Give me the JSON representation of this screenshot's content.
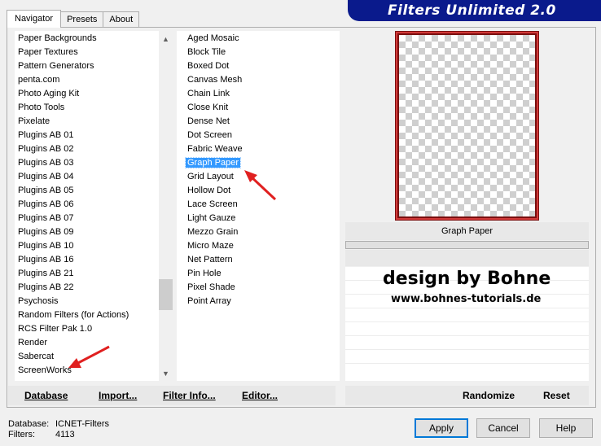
{
  "tabs": [
    {
      "label": "Navigator"
    },
    {
      "label": "Presets"
    },
    {
      "label": "About"
    }
  ],
  "banner": {
    "title": "Filters Unlimited 2.0"
  },
  "categories": [
    "Paper Backgrounds",
    "Paper Textures",
    "Pattern Generators",
    "penta.com",
    "Photo Aging Kit",
    "Photo Tools",
    "Pixelate",
    "Plugins AB 01",
    "Plugins AB 02",
    "Plugins AB 03",
    "Plugins AB 04",
    "Plugins AB 05",
    "Plugins AB 06",
    "Plugins AB 07",
    "Plugins AB 09",
    "Plugins AB 10",
    "Plugins AB 16",
    "Plugins AB 21",
    "Plugins AB 22",
    "Psychosis",
    "Random Filters (for Actions)",
    "RCS Filter Pak 1.0",
    "Render",
    "Sabercat",
    "ScreenWorks"
  ],
  "filters": [
    "Aged Mosaic",
    "Block Tile",
    "Boxed Dot",
    "Canvas Mesh",
    "Chain Link",
    "Close Knit",
    "Dense Net",
    "Dot Screen",
    "Fabric Weave",
    "Graph Paper",
    "Grid Layout",
    "Hollow Dot",
    "Lace Screen",
    "Light Gauze",
    "Mezzo Grain",
    "Micro Maze",
    "Net Pattern",
    "Pin Hole",
    "Pixel Shade",
    "Point Array"
  ],
  "selected_filter_index": 9,
  "preview": {
    "filter_name": "Graph Paper"
  },
  "watermark": {
    "line1": "design by Bohne",
    "line2": "www.bohnes-tutorials.de"
  },
  "toolbar": {
    "database": "Database",
    "import": "Import...",
    "filter_info": "Filter Info...",
    "editor": "Editor...",
    "randomize": "Randomize",
    "reset": "Reset"
  },
  "status": {
    "database_label": "Database:",
    "database_value": "ICNET-Filters",
    "filters_label": "Filters:",
    "filters_value": "4113"
  },
  "buttons": {
    "apply": "Apply",
    "cancel": "Cancel",
    "help": "Help"
  },
  "colors": {
    "banner": "#0a1a8c",
    "selection": "#3399ff",
    "arrow": "#e02020",
    "preview_border": "#7a0f0f"
  }
}
